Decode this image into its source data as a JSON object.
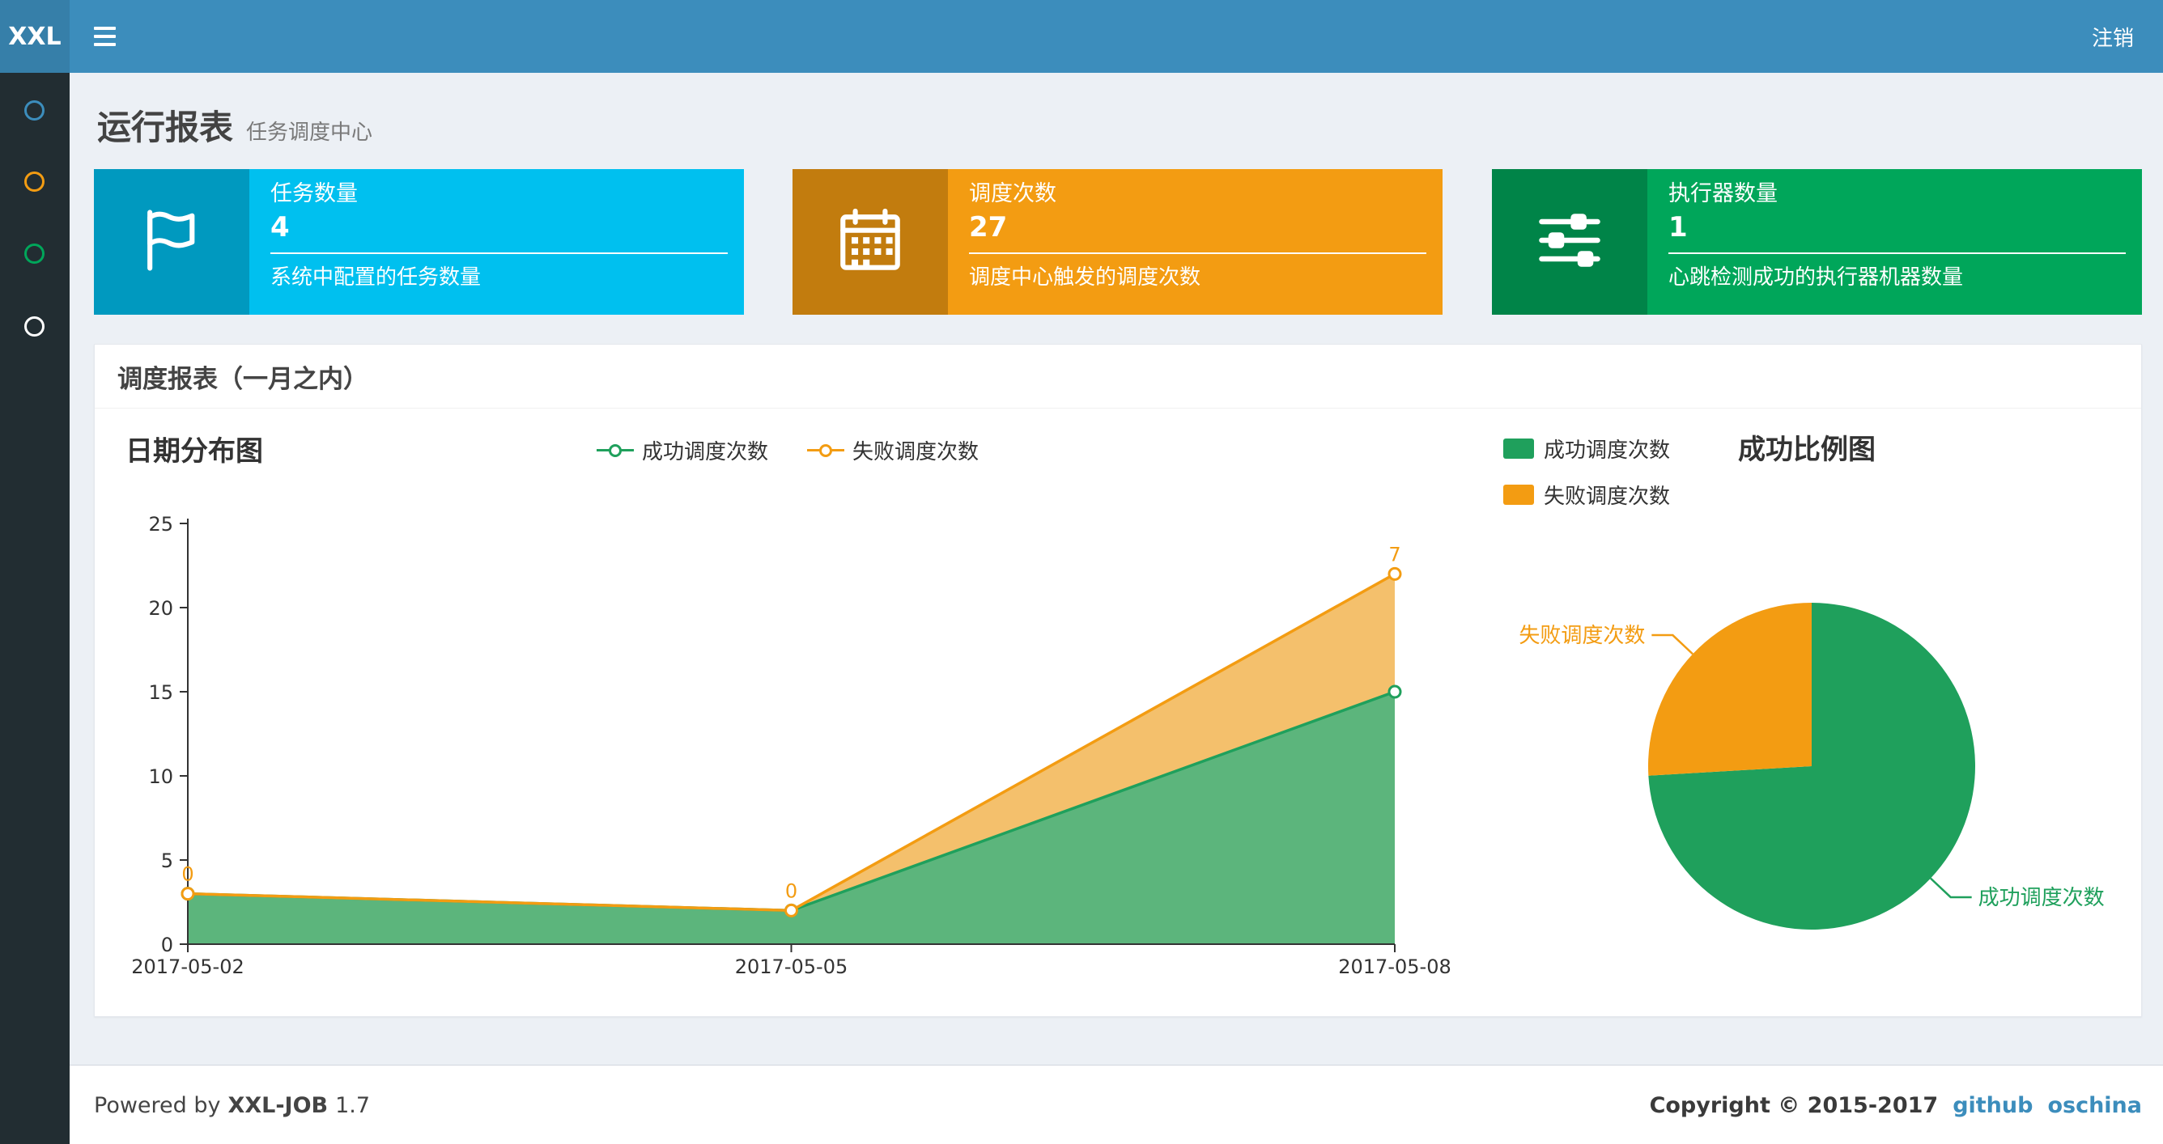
{
  "header": {
    "logo": "XXL",
    "logout": "注销"
  },
  "sidebar": {
    "items": [
      {
        "icon": "circle-icon",
        "color": "#3c8dbc"
      },
      {
        "icon": "circle-icon",
        "color": "#f39c12"
      },
      {
        "icon": "circle-icon",
        "color": "#00a65a"
      },
      {
        "icon": "circle-icon",
        "color": "#ffffff"
      }
    ]
  },
  "page": {
    "title": "运行报表",
    "subtitle": "任务调度中心"
  },
  "info_boxes": [
    {
      "icon": "flag-icon",
      "title": "任务数量",
      "value": "4",
      "desc": "系统中配置的任务数量",
      "color": "#00c0ef"
    },
    {
      "icon": "calendar-icon",
      "title": "调度次数",
      "value": "27",
      "desc": "调度中心触发的调度次数",
      "color": "#f39c12"
    },
    {
      "icon": "sliders-icon",
      "title": "执行器数量",
      "value": "1",
      "desc": "心跳检测成功的执行器机器数量",
      "color": "#00a65a"
    }
  ],
  "panel": {
    "title": "调度报表（一月之内）"
  },
  "chart_data": [
    {
      "type": "area",
      "title": "日期分布图",
      "x": [
        "2017-05-02",
        "2017-05-05",
        "2017-05-08"
      ],
      "stacked": true,
      "series": [
        {
          "name": "成功调度次数",
          "values": [
            3,
            2,
            15
          ],
          "color": "#1fa05c",
          "fill": "#5cb57c",
          "labels": null
        },
        {
          "name": "失败调度次数",
          "values": [
            0,
            0,
            7
          ],
          "color": "#f39c12",
          "fill": "#f4c06c",
          "labels": [
            "0",
            "0",
            "7"
          ]
        }
      ],
      "ylim": [
        0,
        25
      ],
      "yticks": [
        0,
        5,
        10,
        15,
        20,
        25
      ],
      "legend_position": "top-center",
      "grid": false
    },
    {
      "type": "pie",
      "title": "成功比例图",
      "slices": [
        {
          "name": "成功调度次数",
          "value": 20,
          "color": "#1fa05c"
        },
        {
          "name": "失败调度次数",
          "value": 7,
          "color": "#f39c12"
        }
      ],
      "legend_position": "left-of-title"
    }
  ],
  "footer": {
    "powered_prefix": "Powered by",
    "product": "XXL-JOB",
    "version": "1.7",
    "copyright": "Copyright © 2015-2017",
    "links": [
      "github",
      "oschina"
    ]
  }
}
